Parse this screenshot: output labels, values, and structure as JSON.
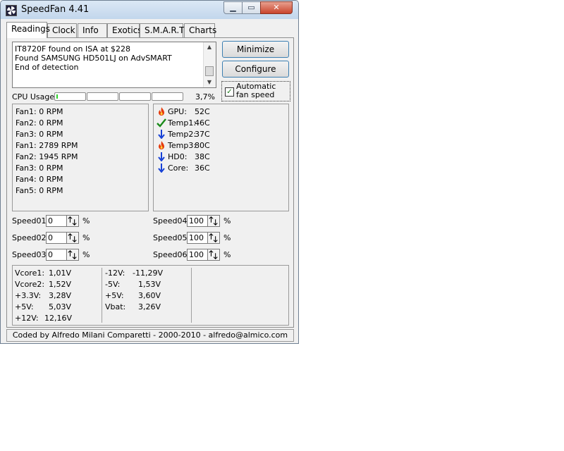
{
  "window": {
    "title": "SpeedFan 4.41"
  },
  "titlebar_buttons": {
    "minimize": "▁",
    "maximize": "▭",
    "close": "✕"
  },
  "tabs": [
    {
      "label": "Readings",
      "active": true
    },
    {
      "label": "Clock"
    },
    {
      "label": "Info"
    },
    {
      "label": "Exotics"
    },
    {
      "label": "S.M.A.R.T."
    },
    {
      "label": "Charts"
    }
  ],
  "log": [
    "IT8720F found on ISA at $228",
    "Found SAMSUNG HD501LJ on AdvSMART",
    "End of detection"
  ],
  "buttons": {
    "minimize": "Minimize",
    "configure": "Configure"
  },
  "auto_fan": {
    "label": "Automatic fan speed",
    "checked": true
  },
  "cpu": {
    "label": "CPU Usage",
    "percent": "3,7%",
    "bars": [
      0.04,
      0.0,
      0.0,
      0.0
    ]
  },
  "fans": [
    "Fan1: 0 RPM",
    "Fan2: 0 RPM",
    "Fan3: 0 RPM",
    "Fan1: 2789 RPM",
    "Fan2: 1945 RPM",
    "Fan3: 0 RPM",
    "Fan4: 0 RPM",
    "Fan5: 0 RPM"
  ],
  "temps": [
    {
      "name": "GPU:",
      "value": "52C",
      "icon": "flame-icon"
    },
    {
      "name": "Temp1:",
      "value": "46C",
      "icon": "checkmark-icon"
    },
    {
      "name": "Temp2:",
      "value": "37C",
      "icon": "down-arrow-icon"
    },
    {
      "name": "Temp3:",
      "value": "80C",
      "icon": "flame-icon"
    },
    {
      "name": "HD0:",
      "value": "38C",
      "icon": "down-arrow-icon"
    },
    {
      "name": "Core:",
      "value": "36C",
      "icon": "down-arrow-icon"
    }
  ],
  "speeds_left": [
    {
      "label": "Speed01:",
      "value": "0",
      "unit": "%"
    },
    {
      "label": "Speed02:",
      "value": "0",
      "unit": "%"
    },
    {
      "label": "Speed03:",
      "value": "0",
      "unit": "%"
    }
  ],
  "speeds_right": [
    {
      "label": "Speed04:",
      "value": "100",
      "unit": "%"
    },
    {
      "label": "Speed05:",
      "value": "100",
      "unit": "%"
    },
    {
      "label": "Speed06:",
      "value": "100",
      "unit": "%"
    }
  ],
  "voltages_left": [
    {
      "name": "Vcore1:",
      "value": "1,01V"
    },
    {
      "name": "Vcore2:",
      "value": "1,52V"
    },
    {
      "name": "+3.3V:",
      "value": "3,28V"
    },
    {
      "name": "+5V:",
      "value": "5,03V"
    },
    {
      "name": "+12V:",
      "value": "12,16V"
    }
  ],
  "voltages_right": [
    {
      "name": "-12V:",
      "value": "-11,29V"
    },
    {
      "name": "-5V:",
      "value": "1,53V"
    },
    {
      "name": "+5V:",
      "value": "3,60V"
    },
    {
      "name": "Vbat:",
      "value": "3,26V"
    }
  ],
  "footer": "Coded by Alfredo Milani Comparetti - 2000-2010 - alfredo@almico.com",
  "colors": {
    "flame": "#e53b0c",
    "check": "#1a8a1a",
    "arrow": "#1540d6",
    "cpu_fill": "#2cd42c"
  }
}
